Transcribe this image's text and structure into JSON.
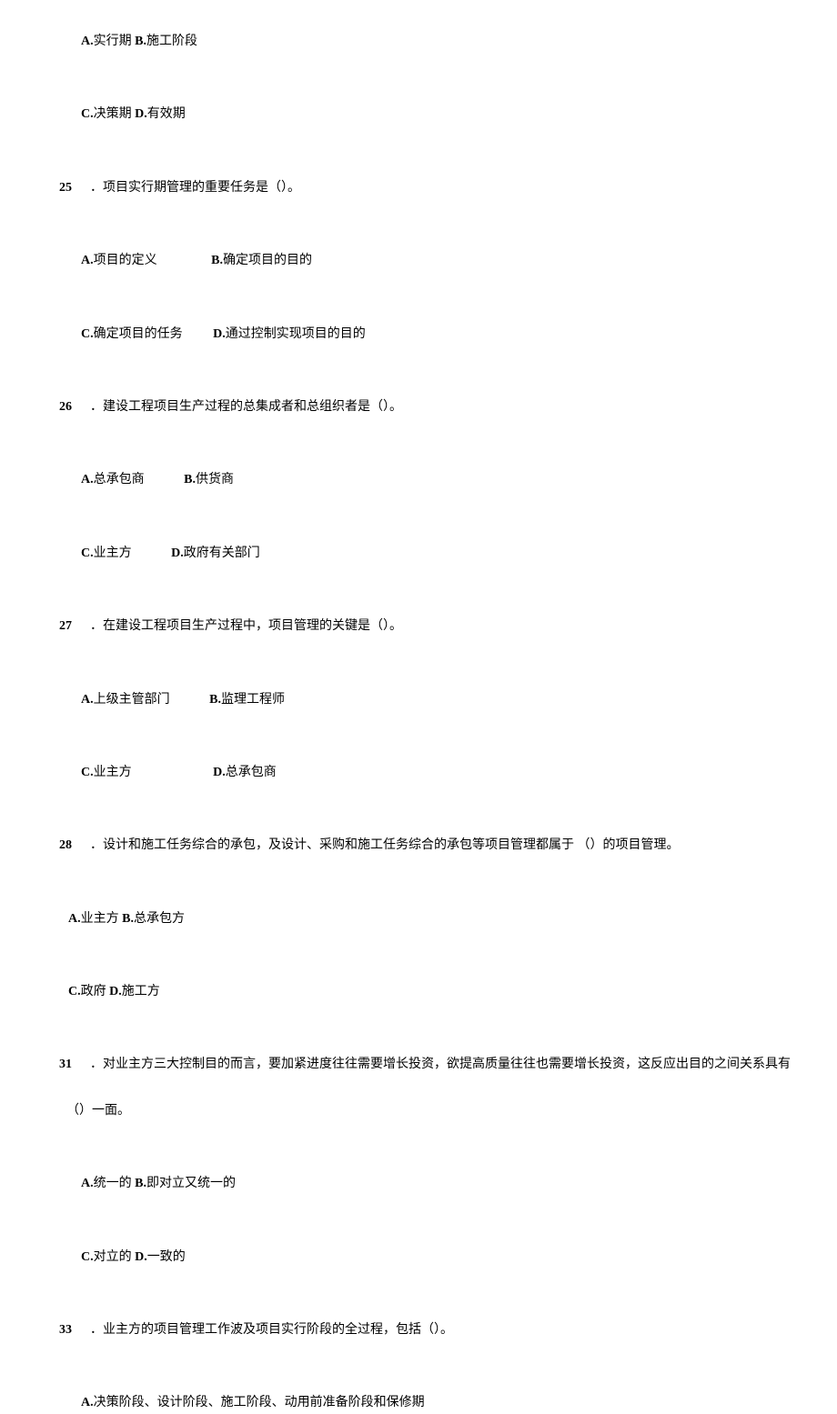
{
  "q24_options_ab": {
    "labelA": "A.",
    "textA": "实行期",
    "labelB": "B.",
    "textB": "施工阶段"
  },
  "q24_options_cd": {
    "labelC": "C.",
    "textC": "决策期",
    "labelD": "D.",
    "textD": "有效期"
  },
  "q25": {
    "num": "25",
    "sep": "．",
    "text": "项目实行期管理的重要任务是（）。"
  },
  "q25_options_ab": {
    "labelA": "A.",
    "textA": "项目的定义",
    "labelB": "B.",
    "textB": "确定项目的目的"
  },
  "q25_options_cd": {
    "labelC": "C.",
    "textC": "确定项目的任务",
    "labelD": "D.",
    "textD": "通过控制实现项目的目的"
  },
  "q26": {
    "num": "26",
    "sep": "．",
    "text": "建设工程项目生产过程的总集成者和总组织者是（）。"
  },
  "q26_options_ab": {
    "labelA": "A.",
    "textA": "总承包商",
    "labelB": "B.",
    "textB": "供货商"
  },
  "q26_options_cd": {
    "labelC": "C.",
    "textC": "业主方",
    "labelD": "D.",
    "textD": "政府有关部门"
  },
  "q27": {
    "num": "27",
    "sep": "．",
    "text": "在建设工程项目生产过程中，项目管理的关键是（）。"
  },
  "q27_options_ab": {
    "labelA": "A.",
    "textA": "上级主管部门",
    "labelB": "B.",
    "textB": "监理工程师"
  },
  "q27_options_cd": {
    "labelC": "C.",
    "textC": "业主方",
    "labelD": "D.",
    "textD": "总承包商"
  },
  "q28": {
    "num": "28",
    "sep": "．",
    "text": "设计和施工任务综合的承包，及设计、采购和施工任务综合的承包等项目管理都属于 （）的项目管理。"
  },
  "q28_options_ab": {
    "labelA": "A.",
    "textA": "业主方",
    "labelB": "B.",
    "textB": "总承包方"
  },
  "q28_options_cd": {
    "labelC": "C.",
    "textC": "政府",
    "labelD": "D.",
    "textD": "施工方"
  },
  "q31": {
    "num": "31",
    "sep": "．",
    "text": "对业主方三大控制目的而言，要加紧进度往往需要增长投资，欲提高质量往往也需要增长投资，这反应出目的之间关系具有",
    "text2": "（）一面。"
  },
  "q31_options_ab": {
    "labelA": "A.",
    "textA": "统一的",
    "labelB": "B.",
    "textB": "即对立又统一的"
  },
  "q31_options_cd": {
    "labelC": "C.",
    "textC": "对立的",
    "labelD": "D.",
    "textD": "一致的"
  },
  "q33": {
    "num": "33",
    "sep": "．",
    "text": "业主方的项目管理工作波及项目实行阶段的全过程，包括（）。"
  },
  "q33_options_a": {
    "labelA": "A.",
    "textA": "决策阶段、设计阶段、施工阶段、动用前准备阶段和保修期"
  }
}
